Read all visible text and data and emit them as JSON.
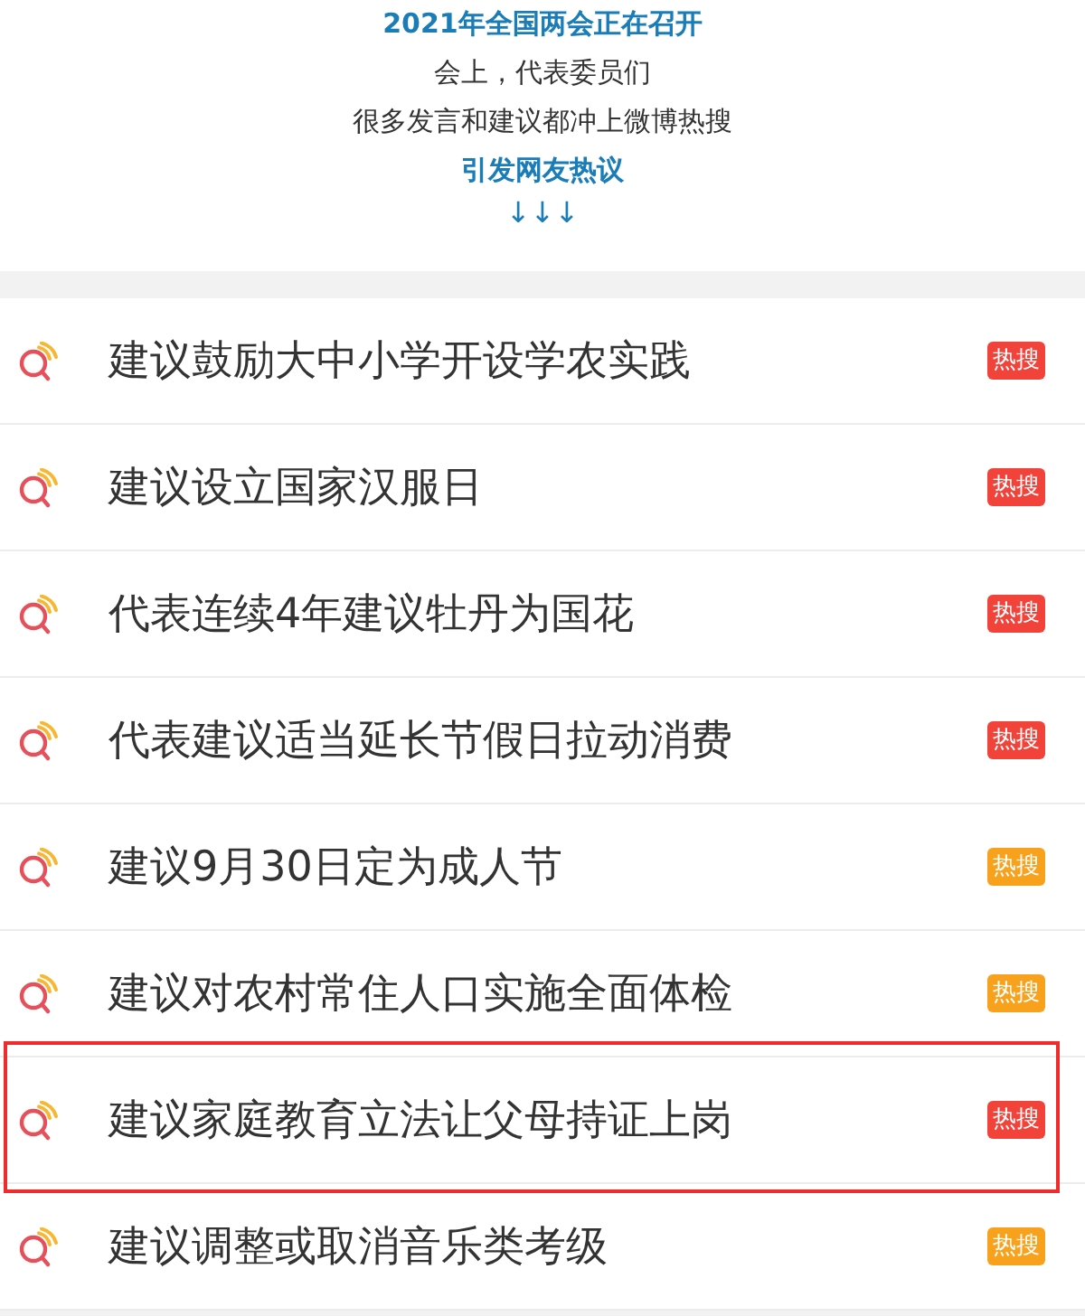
{
  "intro": {
    "lines": [
      {
        "text": "2021年全国两会正在召开",
        "emphasis": true
      },
      {
        "text": "会上，代表委员们",
        "emphasis": false
      },
      {
        "text": "很多发言和建议都冲上微博热搜",
        "emphasis": false
      },
      {
        "text": "引发网友热议",
        "emphasis": true
      }
    ],
    "arrows": "↓↓↓"
  },
  "trending": [
    {
      "title": "建议鼓励大中小学开设学农实践",
      "badge": "热搜",
      "color": "#f2433b",
      "highlighted": false
    },
    {
      "title": "建议设立国家汉服日",
      "badge": "热搜",
      "color": "#f2433b",
      "highlighted": false
    },
    {
      "title": "代表连续4年建议牡丹为国花",
      "badge": "热搜",
      "color": "#f2433b",
      "highlighted": false
    },
    {
      "title": "代表建议适当延长节假日拉动消费",
      "badge": "热搜",
      "color": "#f2433b",
      "highlighted": false
    },
    {
      "title": "建议9月30日定为成人节",
      "badge": "热搜",
      "color": "#f8a11c",
      "highlighted": false
    },
    {
      "title": "建议对农村常住人口实施全面体检",
      "badge": "热搜",
      "color": "#f8a11c",
      "highlighted": false
    },
    {
      "title": "建议家庭教育立法让父母持证上岗",
      "badge": "热搜",
      "color": "#f2433b",
      "highlighted": true
    },
    {
      "title": "建议调整或取消音乐类考级",
      "badge": "热搜",
      "color": "#f8a11c",
      "highlighted": false
    }
  ]
}
